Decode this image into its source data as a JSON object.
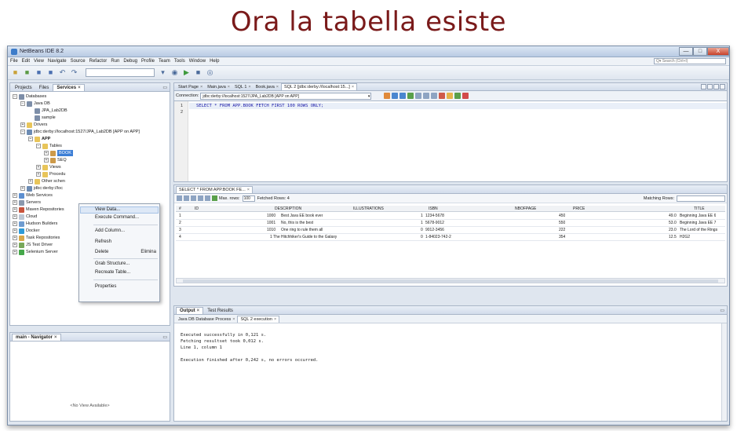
{
  "slide": {
    "title": "Ora la tabella esiste"
  },
  "window": {
    "title": "NetBeans IDE 8.2",
    "controls": {
      "minimize": "—",
      "maximize": "□",
      "close": "X"
    }
  },
  "menubar": {
    "items": [
      "File",
      "Edit",
      "View",
      "Navigate",
      "Source",
      "Refactor",
      "Run",
      "Debug",
      "Profile",
      "Team",
      "Tools",
      "Window",
      "Help"
    ],
    "search_placeholder": "Q▾ Search (Ctrl+I)"
  },
  "left_panel": {
    "tabs": [
      {
        "label": "Projects"
      },
      {
        "label": "Files"
      },
      {
        "label": "Services",
        "close": "×"
      }
    ],
    "minimize": "▭",
    "tree": [
      {
        "label": "Databases",
        "icon": "database-icon"
      },
      {
        "label": "Java DB",
        "icon": "database-icon"
      },
      {
        "label": "JPA_Lab2DB",
        "icon": "database-icon"
      },
      {
        "label": "sample",
        "icon": "database-icon"
      },
      {
        "label": "Drivers",
        "icon": "folder-icon"
      },
      {
        "label": "jdbc:derby://localhost:1527/JPA_Lab2DB [APP on APP]",
        "icon": "connection-icon"
      },
      {
        "label": "APP",
        "icon": "folder-icon"
      },
      {
        "label": "Tables",
        "icon": "folder-icon"
      },
      {
        "label": "BOOK",
        "icon": "table-icon"
      },
      {
        "label": "SEQ",
        "icon": "table-icon"
      },
      {
        "label": "Views",
        "icon": "folder-icon"
      },
      {
        "label": "Procedu",
        "icon": "folder-icon"
      },
      {
        "label": "Other schen",
        "icon": "folder-icon"
      },
      {
        "label": "jdbc:derby://loc",
        "icon": "connection-icon"
      },
      {
        "label": "Web Services",
        "icon": "web-icon"
      },
      {
        "label": "Servers",
        "icon": "server-icon"
      },
      {
        "label": "Maven Repositories",
        "icon": "maven-icon"
      },
      {
        "label": "Cloud",
        "icon": "cloud-icon"
      },
      {
        "label": "Hudson Builders",
        "icon": "hudson-icon"
      },
      {
        "label": "Docker",
        "icon": "docker-icon"
      },
      {
        "label": "Task Repositories",
        "icon": "task-icon"
      },
      {
        "label": "JS Test Driver",
        "icon": "js-icon"
      },
      {
        "label": "Selenium Server",
        "icon": "selenium-icon"
      }
    ],
    "context_menu": {
      "items": [
        "View Data...",
        "Execute Command...",
        "Add Column...",
        "Refresh",
        "Delete",
        "Grab Structure...",
        "Recreate Table...",
        "Properties"
      ],
      "delete_shortcut": "Elimina"
    }
  },
  "navigator": {
    "title": "main - Navigator",
    "close": "×",
    "minimize": "▭",
    "empty_text": "<No View Available>"
  },
  "editor": {
    "tabs": [
      {
        "label": "Start Page",
        "close": "×"
      },
      {
        "label": "Main.java",
        "close": "×"
      },
      {
        "label": "SQL 1",
        "close": "×"
      },
      {
        "label": "Book.java",
        "close": "×"
      },
      {
        "label": "SQL 2 [jdbc:derby://localhost:15...]",
        "close": "×"
      }
    ],
    "connection_label": "Connection:",
    "connection_value": "jdbc:derby://localhost:1527/JPA_Lab2DB [APP on APP]",
    "line_numbers": [
      "1",
      "2"
    ],
    "sql": "SELECT * FROM APP.BOOK FETCH FIRST 100 ROWS ONLY;"
  },
  "results": {
    "tab": "SELECT * FROM APP.BOOK FE...",
    "close": "×",
    "max_rows_label": "Max. rows:",
    "max_rows": "100",
    "fetched_rows_label": "Fetched Rows: 4",
    "matching_label": "Matching Rows:",
    "columns": [
      "#",
      "ID",
      "DESCRIPTION",
      "ILLUSTRATIONS",
      "ISBN",
      "NBOFPAGE",
      "PRICE",
      "TITLE"
    ],
    "rows": [
      [
        "1",
        "1000",
        "Best Java EE book ever",
        "1",
        "1234-5678",
        "450",
        "49.0",
        "Beginning Java EE 6"
      ],
      [
        "2",
        "1001",
        "No, this is the best",
        "1",
        "5678-9012",
        "550",
        "53.0",
        "Beginning Java EE 7"
      ],
      [
        "3",
        "1010",
        "One ring to rule them all",
        "0",
        "9012-3456",
        "222",
        "23.0",
        "The Lord of the Rings"
      ],
      [
        "4",
        "1",
        "The Hitchhiker's Guide to the Galaxy",
        "0",
        "1-84023-742-2",
        "354",
        "12.5",
        "H2G2"
      ]
    ]
  },
  "output": {
    "tabs": [
      {
        "label": "Output",
        "close": "×"
      },
      {
        "label": "Test Results"
      }
    ],
    "subtabs": [
      {
        "label": "Java DB Database Process",
        "close": "×"
      },
      {
        "label": "SQL 2 execution",
        "close": "×"
      }
    ],
    "minimize": "▭",
    "lines": [
      "Executed successfully in 0,121 s.",
      "Fetching resultset took 0,012 s.",
      "Line 1, column 1",
      "",
      "Execution finished after 0,242 s, no errors occurred."
    ]
  }
}
